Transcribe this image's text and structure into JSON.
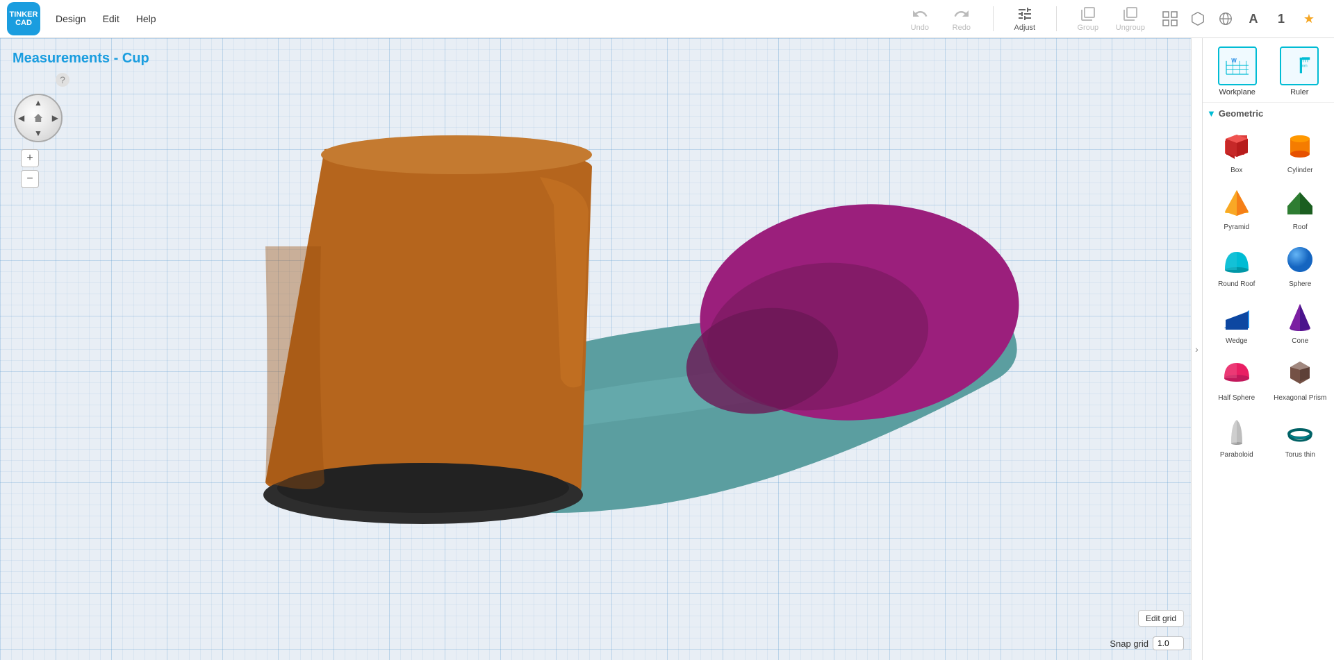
{
  "app": {
    "logo_text": "TINKER\nCAD",
    "title": "Measurements - Cup"
  },
  "menu": {
    "items": [
      "Design",
      "Edit",
      "Help"
    ]
  },
  "toolbar": {
    "undo_label": "Undo",
    "redo_label": "Redo",
    "adjust_label": "Adjust",
    "group_label": "Group",
    "ungroup_label": "Ungroup"
  },
  "panel": {
    "workplane_label": "Workplane",
    "ruler_label": "Ruler",
    "geometric_label": "Geometric",
    "shapes": [
      {
        "id": "box",
        "label": "Box",
        "color": "#e53935"
      },
      {
        "id": "cylinder",
        "label": "Cylinder",
        "color": "#f57c00"
      },
      {
        "id": "pyramid",
        "label": "Pyramid",
        "color": "#ffd600"
      },
      {
        "id": "roof",
        "label": "Roof",
        "color": "#43a047"
      },
      {
        "id": "round-roof",
        "label": "Round Roof",
        "color": "#00bcd4"
      },
      {
        "id": "sphere",
        "label": "Sphere",
        "color": "#1e88e5"
      },
      {
        "id": "wedge",
        "label": "Wedge",
        "color": "#1565c0"
      },
      {
        "id": "cone",
        "label": "Cone",
        "color": "#8e24aa"
      },
      {
        "id": "half-sphere",
        "label": "Half Sphere",
        "color": "#e91e63"
      },
      {
        "id": "hexagonal-prism",
        "label": "Hexagonal Prism",
        "color": "#795548"
      },
      {
        "id": "paraboloid",
        "label": "Paraboloid",
        "color": "#bdbdbd"
      },
      {
        "id": "torus-thin",
        "label": "Torus thin",
        "color": "#006064"
      }
    ]
  },
  "canvas": {
    "snap_grid_label": "Snap grid",
    "snap_grid_value": "1.0",
    "edit_grid_label": "Edit grid",
    "help_label": "?"
  }
}
